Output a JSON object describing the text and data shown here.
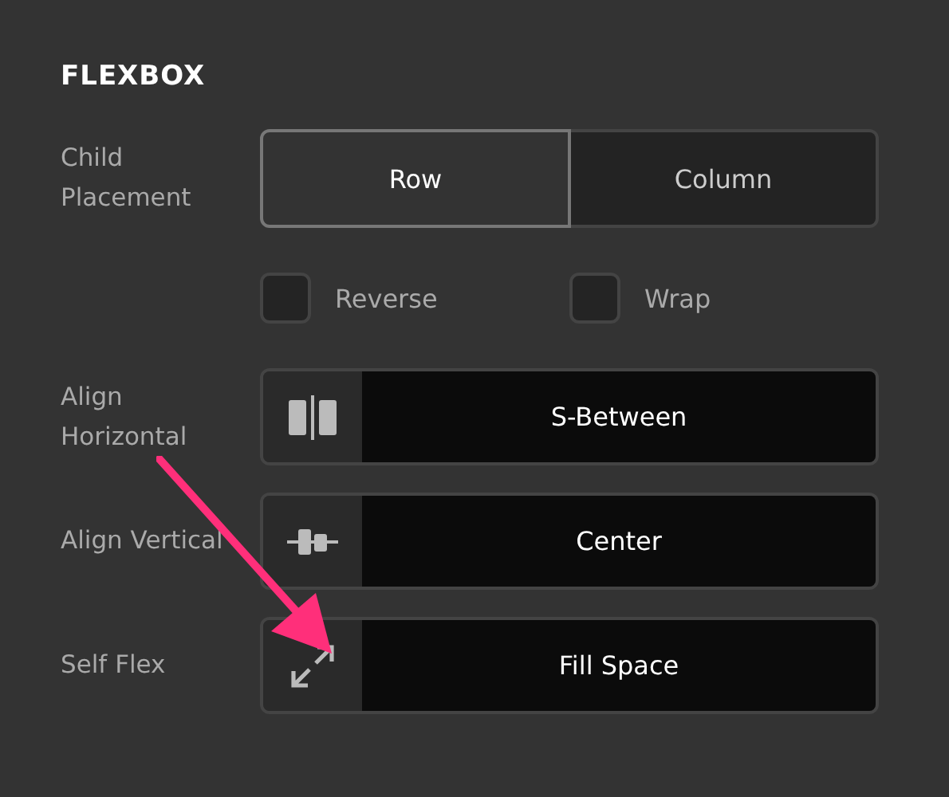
{
  "section": {
    "title": "FLEXBOX"
  },
  "child_placement": {
    "label": "Child Placement",
    "options": [
      {
        "label": "Row",
        "selected": true
      },
      {
        "label": "Column",
        "selected": false
      }
    ],
    "checkboxes": [
      {
        "label": "Reverse",
        "checked": false
      },
      {
        "label": "Wrap",
        "checked": false
      }
    ]
  },
  "selects": [
    {
      "label": "Align Horizontal",
      "kind": "space-between",
      "value": "S-Between"
    },
    {
      "label": "Align Vertical",
      "kind": "center",
      "value": "Center"
    },
    {
      "label": "Self Flex",
      "kind": "expand",
      "value": "Fill Space"
    }
  ],
  "annotation": {
    "kind": "arrow"
  }
}
